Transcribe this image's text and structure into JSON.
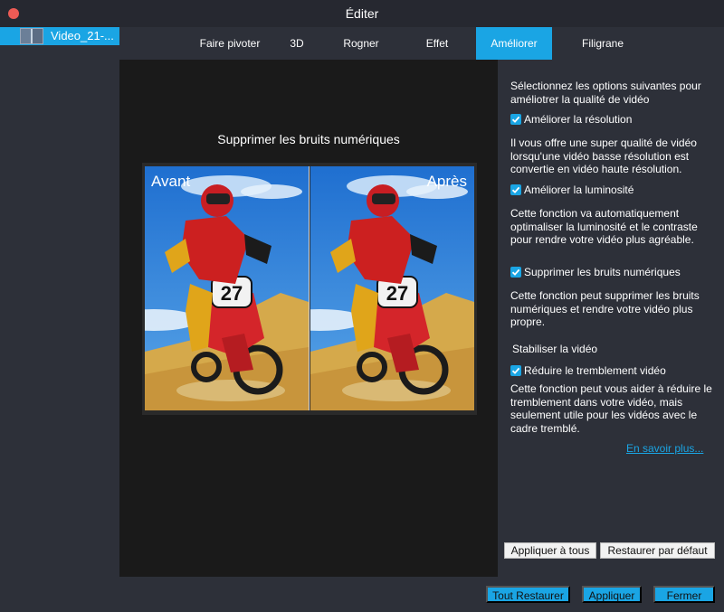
{
  "window": {
    "title": "Éditer",
    "close_icon": "close-dot-icon",
    "close_color": "#ed5b55"
  },
  "sidebar": {
    "file_name": "Video_21-...",
    "thumbnail_icon": "video-thumbnail-icon"
  },
  "tabs": [
    {
      "label": "Faire pivoter",
      "active": false
    },
    {
      "label": "3D",
      "active": false
    },
    {
      "label": "Rogner",
      "active": false
    },
    {
      "label": "Effet",
      "active": false
    },
    {
      "label": "Améliorer",
      "active": true
    },
    {
      "label": "Filigrane",
      "active": false
    }
  ],
  "preview": {
    "title": "Supprimer les bruits numériques",
    "before_label": "Avant",
    "after_label": "Après",
    "rider_number": "27"
  },
  "panel": {
    "intro": "Sélectionnez les options suivantes pour améliotrer la qualité de vidéo",
    "options": [
      {
        "label": "Améliorer la résolution",
        "checked": true,
        "description": "Il vous offre une super qualité de vidéo lorsqu'une vidéo basse résolution est convertie en vidéo haute résolution."
      },
      {
        "label": "Améliorer la luminosité",
        "checked": true,
        "description": "Cette fonction va automatiquement optimaliser la luminosité et le contraste pour rendre votre vidéo plus agréable."
      },
      {
        "label": "Supprimer les bruits numériques",
        "checked": true,
        "description": "Cette fonction peut supprimer les bruits numériques et rendre votre vidéo plus propre."
      }
    ],
    "stabilize_heading": "Stabiliser la vidéo",
    "stabilize_option": {
      "label": "Réduire le tremblement vidéo",
      "checked": true,
      "description": "Cette fonction peut vous aider à réduire le tremblement dans votre vidéo, mais seulement utile pour les vidéos avec le cadre tremblé."
    },
    "learn_more": "En savoir plus...",
    "apply_all": "Appliquer à tous",
    "restore_default": "Restaurer par défaut"
  },
  "footer": {
    "restore_all": "Tout Restaurer",
    "apply": "Appliquer",
    "close": "Fermer"
  },
  "colors": {
    "accent": "#1aa5e4",
    "background": "#2d3039",
    "preview_bg": "#1a1a1a"
  }
}
